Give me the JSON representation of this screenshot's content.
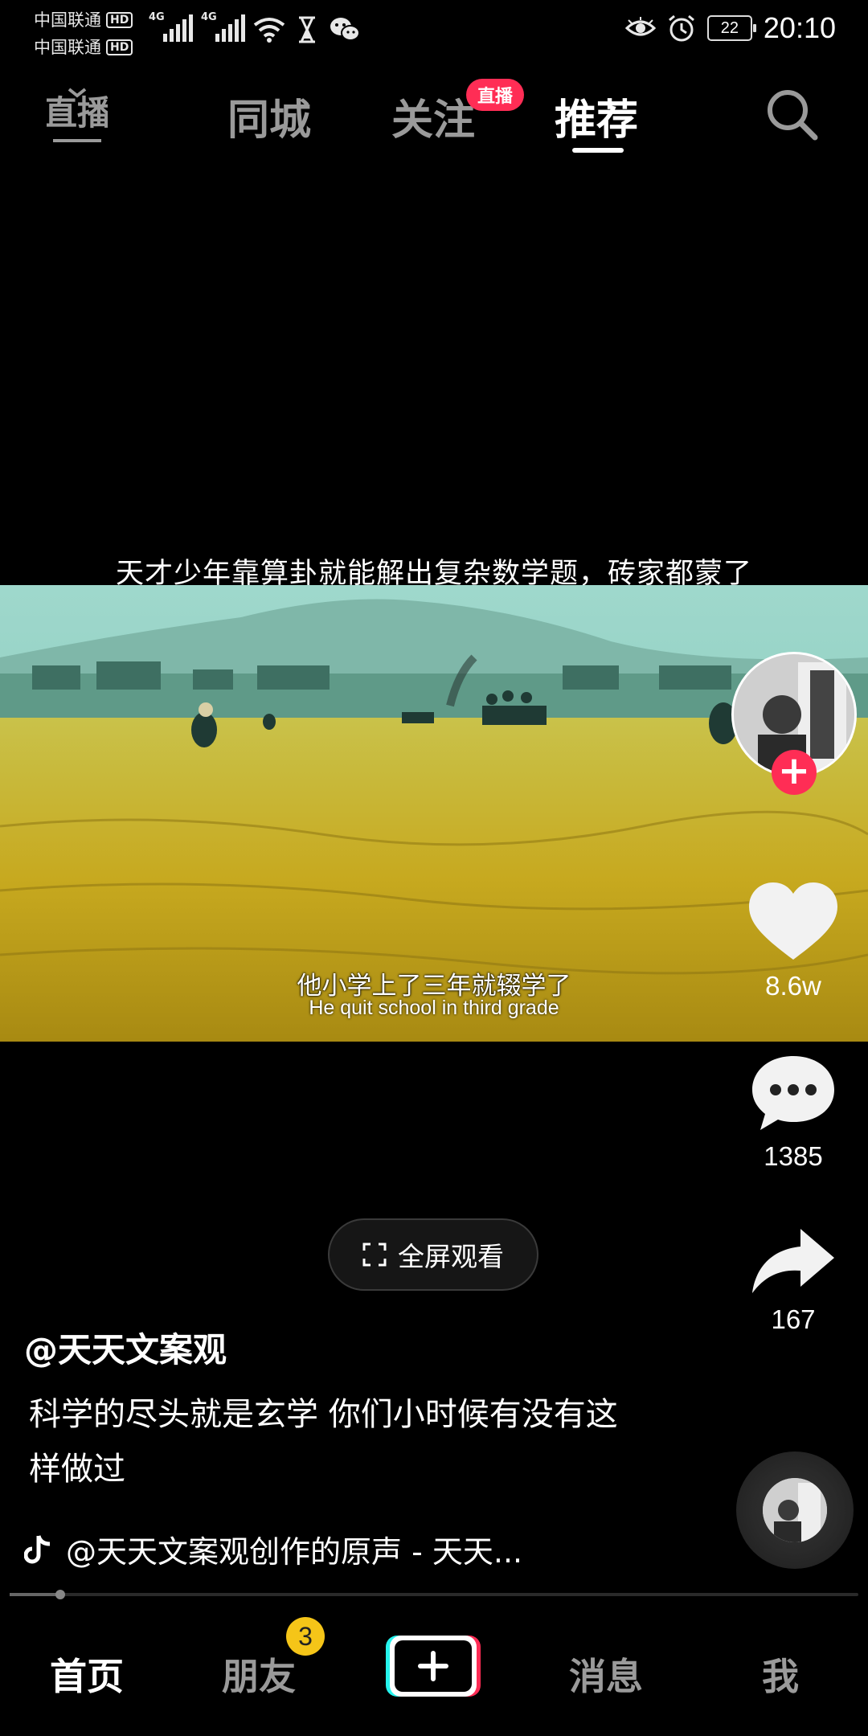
{
  "status_bar": {
    "carrier1": "中国联通",
    "carrier2": "中国联通",
    "hd": "HD",
    "network1": "4G",
    "network2": "4G",
    "battery": "22",
    "time": "20:10"
  },
  "top_nav": {
    "tabs": [
      {
        "label": "同城"
      },
      {
        "label": "关注"
      },
      {
        "label": "推荐"
      }
    ],
    "live_badge": "直播",
    "active_tab": "推荐"
  },
  "video": {
    "title": "天才少年靠算卦就能解出复杂数学题，砖家都蒙了",
    "subtitle_cn": "他小学上了三年就辍学了",
    "subtitle_en": "He quit school in third grade"
  },
  "actions": {
    "likes": "8.6w",
    "comments": "1385",
    "shares": "167"
  },
  "fullscreen_label": "全屏观看",
  "post": {
    "author": "@天天文案观",
    "description": "科学的尽头就是玄学 你们小时候有没有这样做过",
    "music": "@天天文案观创作的原声 - 天天..."
  },
  "progress": {
    "fraction": 0.06
  },
  "bottom_nav": {
    "items": [
      {
        "label": "首页"
      },
      {
        "label": "朋友"
      },
      {
        "label": "消息"
      },
      {
        "label": "我"
      }
    ],
    "friends_badge": "3"
  },
  "colors": {
    "accent": "#ff2d55",
    "badge": "#f5c518"
  },
  "icons": [
    "live-icon",
    "search-icon",
    "heart-icon",
    "comment-icon",
    "share-icon",
    "fullscreen-icon",
    "tiktok-note-icon",
    "plus-icon",
    "wifi-icon",
    "alarm-icon",
    "eye-icon",
    "hourglass-icon",
    "wechat-icon"
  ]
}
